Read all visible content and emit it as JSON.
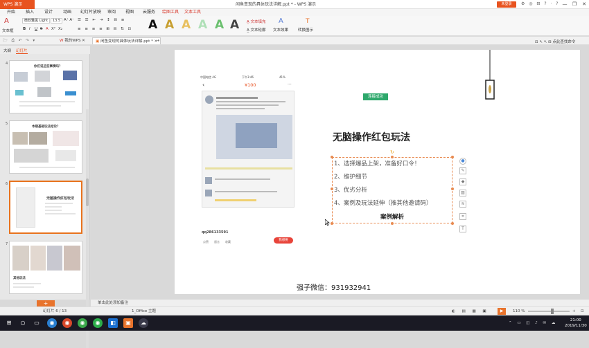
{
  "window": {
    "app_name": "WPS 演示",
    "document_title": "闲鱼变现的具体玩法详解.ppt * - WPS 演示",
    "login_button": "未登录",
    "help_icons": "⚙ ◎ ⊟ ? · ?",
    "minimize": "—",
    "restore": "❐",
    "close": "✕"
  },
  "menu": {
    "items": [
      "开始",
      "插入",
      "设计",
      "动画",
      "幻灯片放映",
      "审阅",
      "视图",
      "云服务",
      "绘图工具",
      "文本工具"
    ]
  },
  "ribbon": {
    "text_box": "文本框",
    "font_name": "微软雅黑 Light",
    "font_size": "13.5",
    "bold": "B",
    "italic": "I",
    "underline": "U",
    "strike": "S",
    "shadow": "A",
    "superscript": "X²",
    "subscript": "X₂",
    "text_fill": "文本填充",
    "text_outline": "文本轮廓",
    "text_effect": "文本效果",
    "special_text": "特殊文字",
    "quick_style_glyph": "A",
    "find_replace": "查找替换",
    "format_painter": "格式刷",
    "change_case": "转换图示"
  },
  "tabs": {
    "items": [
      "我的WPS",
      "闲鱼变现的具体玩法详解.ppt *"
    ],
    "add": "+",
    "right_tools": "⊡ ↖ ↖ ⊟  点此查找命令"
  },
  "left_panel": {
    "tab_outline": "大纲",
    "tab_slides": "幻灯片",
    "slide_numbers": [
      "4",
      "5",
      "6",
      "7"
    ],
    "thumb4_title": "你们说这些事情吗？",
    "thumb5_title": "本期基础玩法结论？",
    "thumb6_title": "无脑操作红包玩法",
    "thumb7_text": "其他玩法"
  },
  "slide": {
    "phone_status_left": "中国电信 4G",
    "phone_status_time": "下午3:46",
    "phone_status_right": "41%",
    "phone_top_count": "100",
    "phone_back": "‹",
    "phone_more": "···",
    "phone_user": "qq286133591",
    "phone_chat_button": "我想要",
    "phone_bottom_icons": [
      "点赞",
      "留言",
      "收藏"
    ],
    "success_tag": "连接成功",
    "title": "无脑操作红包玩法",
    "list": [
      "1、选择爆品上架，准备好口令！",
      "2、维护细节",
      "3、优劣分析",
      "4、案例及玩法延伸（推其他邀请码）"
    ],
    "subtitle": "案例解析",
    "footer": "强子微信：931932941"
  },
  "notes": {
    "placeholder": "单击此处添加备注"
  },
  "status": {
    "slide_counter": "幻灯片 6 / 13",
    "theme": "1_Office 主题",
    "zoom": "110 %",
    "zoom_minus": "-",
    "zoom_plus": "+",
    "fit": "⊡"
  },
  "taskbar": {
    "clock_time": "21:00",
    "clock_date": "2019/11/30"
  },
  "colors": {
    "accent": "#e8531f",
    "selection": "#e8721c",
    "success": "#2da86b"
  }
}
